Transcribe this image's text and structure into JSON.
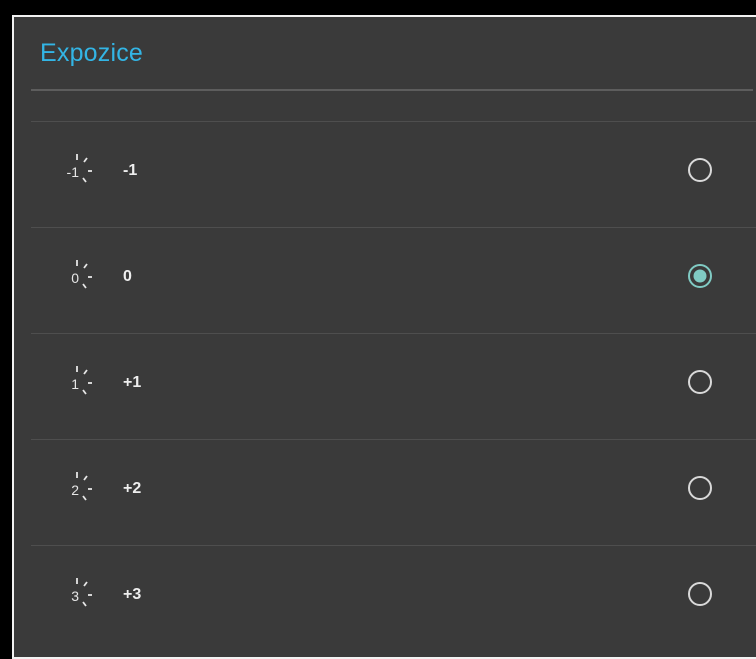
{
  "dialog": {
    "title": "Expozice",
    "accent_color": "#33b5e5",
    "options": [
      {
        "icon_value": "-1",
        "label": "-1",
        "selected": false,
        "icon": "exposure-minus-1-icon"
      },
      {
        "icon_value": "0",
        "label": "0",
        "selected": true,
        "icon": "exposure-0-icon"
      },
      {
        "icon_value": "1",
        "label": "+1",
        "selected": false,
        "icon": "exposure-plus-1-icon"
      },
      {
        "icon_value": "2",
        "label": "+2",
        "selected": false,
        "icon": "exposure-plus-2-icon"
      },
      {
        "icon_value": "3",
        "label": "+3",
        "selected": false,
        "icon": "exposure-plus-3-icon"
      }
    ],
    "radio_selected_color": "#80cbc4",
    "radio_unselected_color": "#d9d9d9"
  }
}
